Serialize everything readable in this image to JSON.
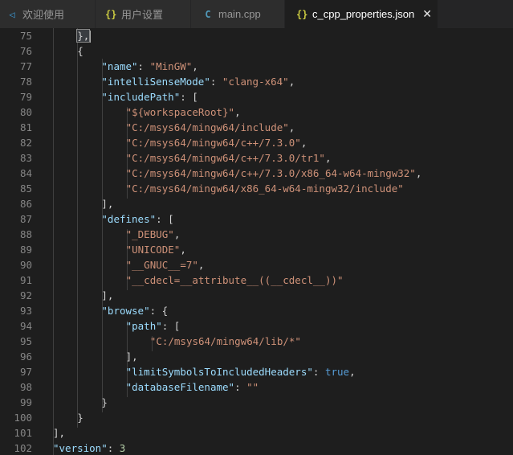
{
  "tabs": [
    {
      "label": "欢迎使用",
      "icon": "vscode-logo-icon",
      "icon_glyph": "◁",
      "active": false
    },
    {
      "label": "用户设置",
      "icon": "json-braces-icon",
      "icon_glyph": "{}",
      "active": false
    },
    {
      "label": "main.cpp",
      "icon": "cpp-file-icon",
      "icon_glyph": "C",
      "active": false
    },
    {
      "label": "c_cpp_properties.json",
      "icon": "json-braces-icon",
      "icon_glyph": "{}",
      "active": true,
      "close_glyph": "✕"
    }
  ],
  "lines": [
    {
      "n": "75",
      "tokens": [
        {
          "t": "},",
          "c": "p"
        }
      ]
    },
    {
      "n": "76",
      "tokens": [
        {
          "t": "{",
          "c": "p"
        }
      ]
    },
    {
      "n": "77",
      "tokens": [
        {
          "t": "\"name\"",
          "c": "k"
        },
        {
          "t": ": ",
          "c": "p"
        },
        {
          "t": "\"MinGW\"",
          "c": "s"
        },
        {
          "t": ",",
          "c": "p"
        }
      ]
    },
    {
      "n": "78",
      "tokens": [
        {
          "t": "\"intelliSenseMode\"",
          "c": "k"
        },
        {
          "t": ": ",
          "c": "p"
        },
        {
          "t": "\"clang-x64\"",
          "c": "s"
        },
        {
          "t": ",",
          "c": "p"
        }
      ]
    },
    {
      "n": "79",
      "tokens": [
        {
          "t": "\"includePath\"",
          "c": "k"
        },
        {
          "t": ": [",
          "c": "p"
        }
      ]
    },
    {
      "n": "80",
      "tokens": [
        {
          "t": "\"${workspaceRoot}\"",
          "c": "s"
        },
        {
          "t": ",",
          "c": "p"
        }
      ]
    },
    {
      "n": "81",
      "tokens": [
        {
          "t": "\"C:/msys64/mingw64/include\"",
          "c": "s"
        },
        {
          "t": ",",
          "c": "p"
        }
      ]
    },
    {
      "n": "82",
      "tokens": [
        {
          "t": "\"C:/msys64/mingw64/c++/7.3.0\"",
          "c": "s"
        },
        {
          "t": ",",
          "c": "p"
        }
      ]
    },
    {
      "n": "83",
      "tokens": [
        {
          "t": "\"C:/msys64/mingw64/c++/7.3.0/tr1\"",
          "c": "s"
        },
        {
          "t": ",",
          "c": "p"
        }
      ]
    },
    {
      "n": "84",
      "tokens": [
        {
          "t": "\"C:/msys64/mingw64/c++/7.3.0/x86_64-w64-mingw32\"",
          "c": "s"
        },
        {
          "t": ",",
          "c": "p"
        }
      ]
    },
    {
      "n": "85",
      "tokens": [
        {
          "t": "\"C:/msys64/mingw64/x86_64-w64-mingw32/include\"",
          "c": "s"
        }
      ]
    },
    {
      "n": "86",
      "tokens": [
        {
          "t": "],",
          "c": "p"
        }
      ]
    },
    {
      "n": "87",
      "tokens": [
        {
          "t": "\"defines\"",
          "c": "k"
        },
        {
          "t": ": [",
          "c": "p"
        }
      ]
    },
    {
      "n": "88",
      "tokens": [
        {
          "t": "\"_DEBUG\"",
          "c": "s"
        },
        {
          "t": ",",
          "c": "p"
        }
      ]
    },
    {
      "n": "89",
      "tokens": [
        {
          "t": "\"UNICODE\"",
          "c": "s"
        },
        {
          "t": ",",
          "c": "p"
        }
      ]
    },
    {
      "n": "90",
      "tokens": [
        {
          "t": "\"__GNUC__=7\"",
          "c": "s"
        },
        {
          "t": ",",
          "c": "p"
        }
      ]
    },
    {
      "n": "91",
      "tokens": [
        {
          "t": "\"__cdecl=__attribute__((__cdecl__))\"",
          "c": "s"
        }
      ]
    },
    {
      "n": "92",
      "tokens": [
        {
          "t": "],",
          "c": "p"
        }
      ]
    },
    {
      "n": "93",
      "tokens": [
        {
          "t": "\"browse\"",
          "c": "k"
        },
        {
          "t": ": {",
          "c": "p"
        }
      ]
    },
    {
      "n": "94",
      "tokens": [
        {
          "t": "\"path\"",
          "c": "k"
        },
        {
          "t": ": [",
          "c": "p"
        }
      ]
    },
    {
      "n": "95",
      "tokens": [
        {
          "t": "\"C:/msys64/mingw64/lib/*\"",
          "c": "s"
        }
      ]
    },
    {
      "n": "96",
      "tokens": [
        {
          "t": "],",
          "c": "p"
        }
      ]
    },
    {
      "n": "97",
      "tokens": [
        {
          "t": "\"limitSymbolsToIncludedHeaders\"",
          "c": "k"
        },
        {
          "t": ": ",
          "c": "p"
        },
        {
          "t": "true",
          "c": "b"
        },
        {
          "t": ",",
          "c": "p"
        }
      ]
    },
    {
      "n": "98",
      "tokens": [
        {
          "t": "\"databaseFilename\"",
          "c": "k"
        },
        {
          "t": ": ",
          "c": "p"
        },
        {
          "t": "\"\"",
          "c": "s"
        }
      ]
    },
    {
      "n": "99",
      "tokens": [
        {
          "t": "}",
          "c": "p"
        }
      ]
    },
    {
      "n": "100",
      "tokens": [
        {
          "t": "}",
          "c": "p"
        }
      ]
    },
    {
      "n": "101",
      "tokens": [
        {
          "t": "],",
          "c": "p"
        }
      ]
    },
    {
      "n": "102",
      "tokens": [
        {
          "t": "\"version\"",
          "c": "k"
        },
        {
          "t": ": ",
          "c": "p"
        },
        {
          "t": "3",
          "c": "n"
        }
      ]
    }
  ],
  "colors": {
    "editor_bg": "#1e1e1e",
    "key": "#9cdcfe",
    "string": "#ce9178",
    "boolean": "#569cd6",
    "number": "#b5cea8",
    "line_number": "#858585"
  }
}
